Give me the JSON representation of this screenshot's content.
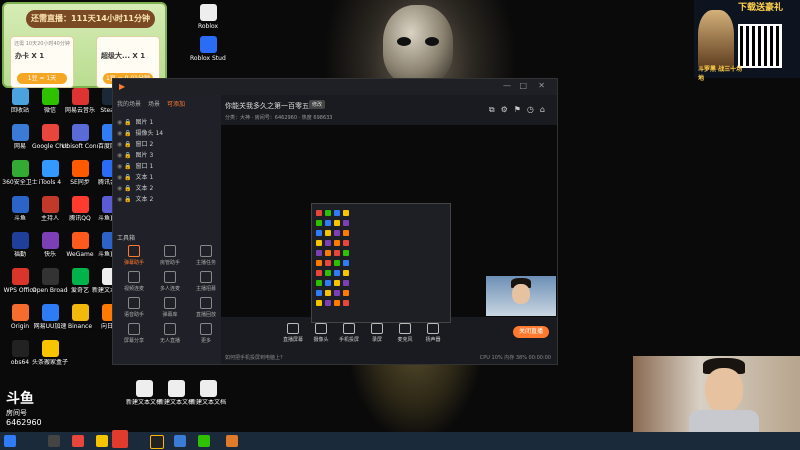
{
  "overlay_card": {
    "header": "还需直播：111天14小时11分钟",
    "tile1": {
      "top": "还需 10天20小时40分钟",
      "name": "办卡 X 1",
      "btn": "1豆 = 1天"
    },
    "tile2": {
      "name": "超级大... X 1",
      "btn": "1豆 = 0.01分钟"
    }
  },
  "promo": {
    "title": "下载送豪礼",
    "subtitle": "斗罗黑 战三十场地"
  },
  "desktop_icons": [
    {
      "label": "回收站",
      "color": "#4aa3df"
    },
    {
      "label": "微信",
      "color": "#2dc100"
    },
    {
      "label": "网易云音乐",
      "color": "#d33"
    },
    {
      "label": "Steam",
      "color": "#1b2838"
    },
    {
      "label": "网易",
      "color": "#3a7bd5"
    },
    {
      "label": "Google Chrome",
      "color": "#e8453c"
    },
    {
      "label": "Ubisoft Connect",
      "color": "#5a6bd8"
    },
    {
      "label": "百度网盘",
      "color": "#2f7cf6"
    },
    {
      "label": "360安全卫士",
      "color": "#33aa33"
    },
    {
      "label": "iTools 4",
      "color": "#3399ff"
    },
    {
      "label": "SE同步",
      "color": "#ff5a00"
    },
    {
      "label": "腾讯会议",
      "color": "#2b6cf6"
    },
    {
      "label": "斗鱼",
      "color": "#2b63c7"
    },
    {
      "label": "主持人",
      "color": "#c0392b"
    },
    {
      "label": "腾讯QQ",
      "color": "#ff3b30"
    },
    {
      "label": "斗鱼直播",
      "color": "#5b5bd6"
    },
    {
      "label": "福勤",
      "color": "#1f3f9a"
    },
    {
      "label": "快乐",
      "color": "#7d3fb5"
    },
    {
      "label": "WeGame",
      "color": "#ff5a1e"
    },
    {
      "label": "斗鱼直播",
      "color": "#2b63c7"
    },
    {
      "label": "WPS Office",
      "color": "#d9352a"
    },
    {
      "label": "Open Broadcast",
      "color": "#333"
    },
    {
      "label": "爱奇艺",
      "color": "#00b34a"
    },
    {
      "label": "新建文本文档",
      "color": "#eeeeee"
    },
    {
      "label": "Origin",
      "color": "#f56c2d"
    },
    {
      "label": "网易UU加速",
      "color": "#2d7cf6"
    },
    {
      "label": "Binance",
      "color": "#f0b90b"
    },
    {
      "label": "向日葵",
      "color": "#ff7a00"
    },
    {
      "label": "obs64",
      "color": "#222222"
    },
    {
      "label": "头条搬家盒子",
      "color": "#f7c500"
    },
    {
      "label": "新建文本文档 (6)",
      "color": "#eeeeee"
    },
    {
      "label": "新建文本文档",
      "color": "#eeeeee"
    },
    {
      "label": "新建文本文档",
      "color": "#eeeeee"
    },
    {
      "label": "Roblox",
      "color": "#eeeeee"
    },
    {
      "label": "Roblox Studio",
      "color": "#2b6cf6"
    }
  ],
  "app": {
    "tabs": [
      "我的场景",
      "场景",
      "可添加"
    ],
    "sources": [
      "图片 1",
      "摄像头 14",
      "窗口 2",
      "图片 3",
      "窗口 1",
      "文本 1",
      "文本 2",
      "文本 2"
    ],
    "tools_label": "工具箱",
    "tools": [
      "弹幕助手",
      "房管助手",
      "主播任务",
      "视频连麦",
      "多人连麦",
      "主播招募",
      "语音助手",
      "弹幕库",
      "直播回放",
      "屏幕分享",
      "无人直播",
      "更多"
    ],
    "room_title": "你能关我多久之第一百零五天!",
    "tag": "修改",
    "meta": "分类：大神 · 房间号：6462960 · 热度 698633",
    "bottom_buttons": [
      "直播屏幕",
      "摄像头",
      "手机投屏",
      "录屏",
      "麦克风",
      "扬声器"
    ],
    "live_btn": "关闭直播",
    "status_left": "如何把手机投屏到电脑上?",
    "status_right": "CPU 10% 内存 38% 00:00:00"
  },
  "watermark": {
    "logo": "斗鱼",
    "brand": "房间号",
    "room": "6462960"
  }
}
